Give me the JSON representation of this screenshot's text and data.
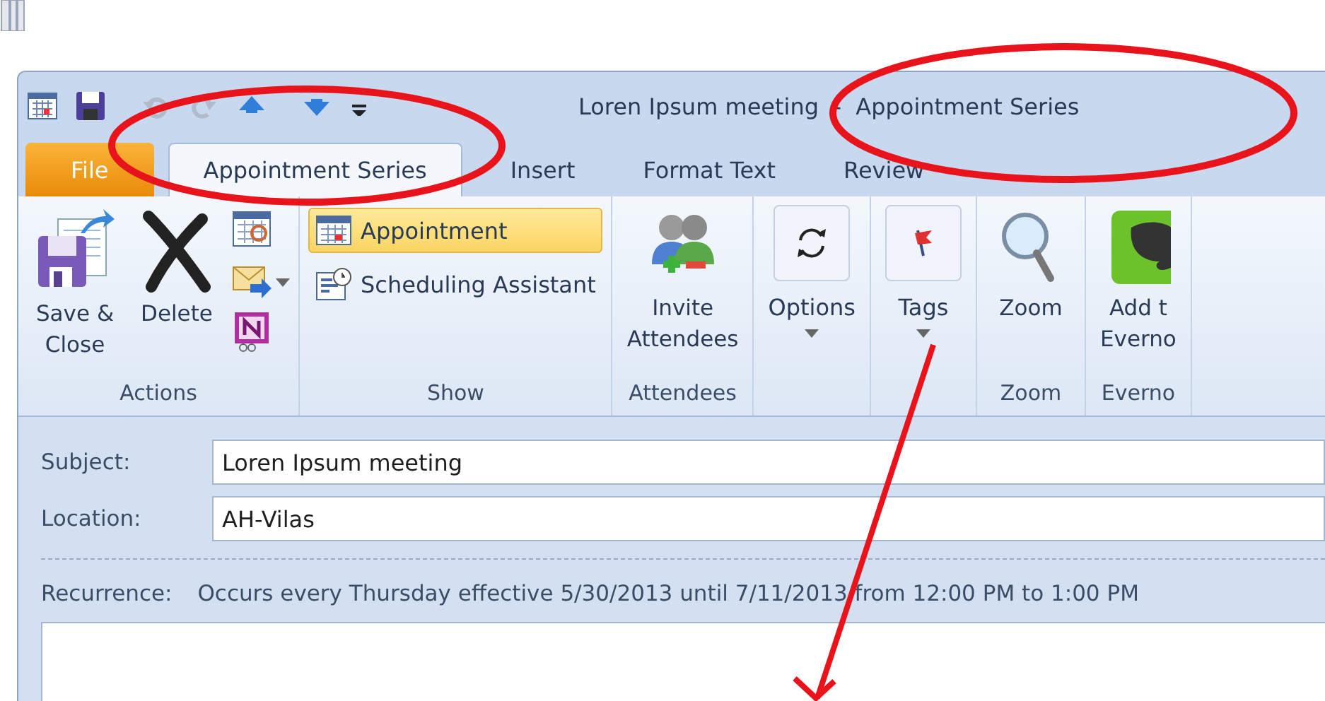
{
  "quick_access": [
    {
      "kind": "calendar",
      "disabled": false
    },
    {
      "kind": "save",
      "disabled": false
    },
    {
      "kind": "undo",
      "disabled": true
    },
    {
      "kind": "redo",
      "disabled": true
    },
    {
      "kind": "up",
      "disabled": false
    },
    {
      "kind": "down",
      "disabled": false
    },
    {
      "kind": "customize",
      "disabled": false
    }
  ],
  "window": {
    "title": "Loren Ipsum meeting  -  Appointment Series"
  },
  "tabs": [
    {
      "label": "File",
      "kind": "file",
      "selected": false
    },
    {
      "label": "Appointment Series",
      "kind": "tab",
      "selected": true
    },
    {
      "label": "Insert",
      "kind": "tab",
      "selected": false
    },
    {
      "label": "Format Text",
      "kind": "tab",
      "selected": false
    },
    {
      "label": "Review",
      "kind": "tab",
      "selected": false
    }
  ],
  "ribbon_groups": [
    {
      "label": "Actions",
      "items": [
        {
          "kind": "large",
          "label": "Save &\nClose"
        },
        {
          "kind": "large",
          "label": "Delete"
        },
        {
          "kind": "icon-stack",
          "buttons": [
            {
              "dropdown": false
            },
            {
              "dropdown": true
            },
            {
              "dropdown": false
            }
          ]
        }
      ]
    },
    {
      "label": "Show",
      "items": [
        {
          "kind": "small-stack",
          "buttons": [
            {
              "label": "Appointment",
              "selected": true
            },
            {
              "label": "Scheduling Assistant",
              "selected": false
            }
          ]
        }
      ]
    },
    {
      "label": "Attendees",
      "items": [
        {
          "kind": "large",
          "label": "Invite\nAttendees"
        }
      ]
    },
    {
      "items": [
        {
          "kind": "boxed",
          "label": "Options",
          "dropdown": true
        }
      ]
    },
    {
      "items": [
        {
          "kind": "boxed",
          "label": "Tags",
          "dropdown": true
        }
      ]
    },
    {
      "label": "Zoom",
      "items": [
        {
          "kind": "large",
          "label": "Zoom"
        }
      ]
    },
    {
      "label": "Everno",
      "items": [
        {
          "kind": "large",
          "label": "Add t\nEverno"
        }
      ]
    }
  ],
  "form": {
    "fields": [
      {
        "label": "Subject:",
        "value": "Loren Ipsum meeting"
      },
      {
        "label": "Location:",
        "value": "AH-Vilas"
      }
    ],
    "recurrence": {
      "label": "Recurrence:",
      "text": "Occurs every Thursday effective 5/30/2013 until 7/11/2013 from 12:00 PM to 1:00 PM"
    }
  }
}
